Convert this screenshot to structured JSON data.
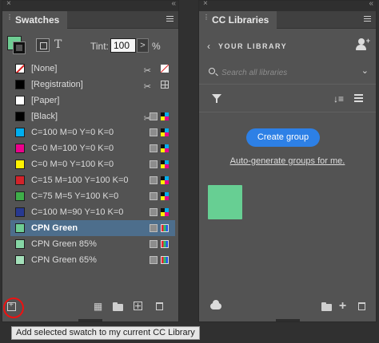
{
  "swatches_panel": {
    "close_glyph": "×",
    "collapse_glyph": "«",
    "tab_title": "Swatches",
    "tint_label": "Tint:",
    "tint_value": "100",
    "tint_arrow": ">",
    "tint_unit": "%",
    "items": [
      {
        "name": "[None]",
        "color": "#ffffff"
      },
      {
        "name": "[Registration]",
        "color": "#000000"
      },
      {
        "name": "[Paper]",
        "color": "#ffffff"
      },
      {
        "name": "[Black]",
        "color": "#000000"
      },
      {
        "name": "C=100 M=0 Y=0 K=0",
        "color": "#00aeef"
      },
      {
        "name": "C=0 M=100 Y=0 K=0",
        "color": "#ec008c"
      },
      {
        "name": "C=0 M=0 Y=100 K=0",
        "color": "#fff200"
      },
      {
        "name": "C=15 M=100 Y=100 K=0",
        "color": "#d2232a"
      },
      {
        "name": "C=75 M=5 Y=100 K=0",
        "color": "#3fae49"
      },
      {
        "name": "C=100 M=90 Y=10 K=0",
        "color": "#283991"
      },
      {
        "name": "CPN Green",
        "color": "#6ecd93"
      },
      {
        "name": "CPN Green 85%",
        "color": "#86d6a5"
      },
      {
        "name": "CPN Green 65%",
        "color": "#a4e0ba"
      }
    ]
  },
  "tooltip": {
    "text": "Add selected swatch to my current CC Library"
  },
  "cc_libraries_panel": {
    "close_glyph": "×",
    "collapse_glyph": "«",
    "tab_title": "CC Libraries",
    "back_glyph": "‹",
    "library_name": "YOUR LIBRARY",
    "search_placeholder": "Search all libraries",
    "dropdown_glyph": "⌄",
    "sort_glyph": "↓≡",
    "create_group_label": "Create group",
    "auto_generate_link": "Auto-generate groups for me.",
    "library_swatch_color": "#67cf93"
  },
  "colors": {
    "panel_bg": "#535353",
    "selected_row": "#4d6e8c",
    "accent_blue": "#2d80e6",
    "highlight_red": "#ee1111"
  }
}
